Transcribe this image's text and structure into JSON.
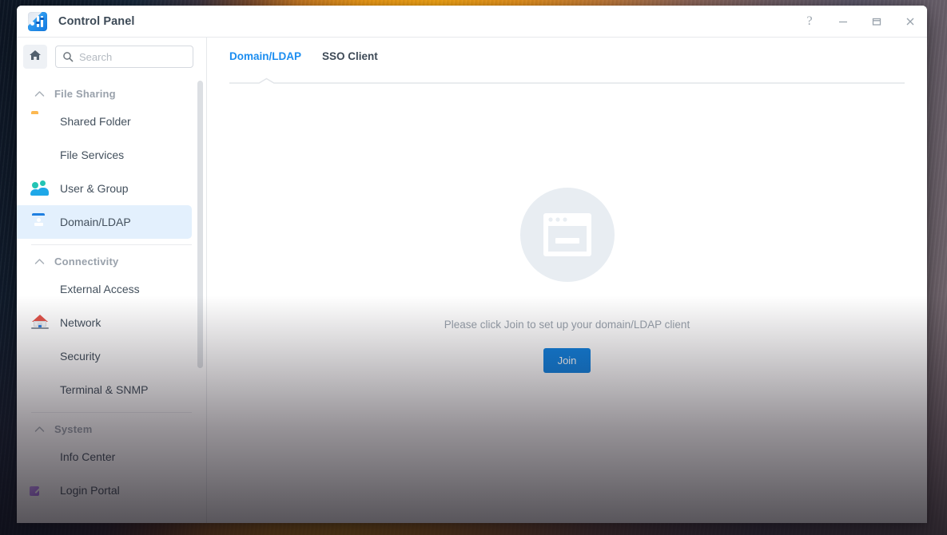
{
  "window": {
    "title": "Control Panel",
    "app_icon": "control-panel-icon",
    "controls": [
      {
        "name": "help-button",
        "glyph": "?"
      },
      {
        "name": "minimize-button",
        "glyph": "—"
      },
      {
        "name": "maximize-button",
        "glyph": "▭"
      },
      {
        "name": "close-button",
        "glyph": "✕"
      }
    ]
  },
  "sidebar": {
    "home_icon": "home-icon",
    "search": {
      "placeholder": "Search",
      "value": "",
      "icon": "search-icon"
    },
    "sections": [
      {
        "label": "File Sharing",
        "collapse_icon": "chevron-up-icon",
        "items": [
          {
            "label": "Shared Folder",
            "icon": "shared-folder-icon",
            "active": false
          },
          {
            "label": "File Services",
            "icon": "file-services-icon",
            "active": false
          },
          {
            "label": "User & Group",
            "icon": "user-group-icon",
            "active": false
          },
          {
            "label": "Domain/LDAP",
            "icon": "domain-ldap-icon",
            "active": true
          }
        ]
      },
      {
        "label": "Connectivity",
        "collapse_icon": "chevron-up-icon",
        "items": [
          {
            "label": "External Access",
            "icon": "external-access-icon",
            "active": false
          },
          {
            "label": "Network",
            "icon": "network-icon",
            "active": false
          },
          {
            "label": "Security",
            "icon": "security-shield-icon",
            "active": false
          },
          {
            "label": "Terminal & SNMP",
            "icon": "terminal-icon",
            "active": false
          }
        ]
      },
      {
        "label": "System",
        "collapse_icon": "chevron-up-icon",
        "items": [
          {
            "label": "Info Center",
            "icon": "info-center-icon",
            "active": false
          },
          {
            "label": "Login Portal",
            "icon": "login-portal-icon",
            "active": false
          }
        ]
      }
    ]
  },
  "main": {
    "tabs": [
      {
        "label": "Domain/LDAP",
        "active": true
      },
      {
        "label": "SSO Client",
        "active": false
      }
    ],
    "empty_state": {
      "illustration": "window-placeholder-icon",
      "message": "Please click Join to set up your domain/LDAP client",
      "button_label": "Join"
    }
  },
  "colors": {
    "accent": "#1b8df0",
    "button": "#1283e1",
    "active_item_bg": "#e3f0fd",
    "muted_text": "#9aa3ad"
  }
}
